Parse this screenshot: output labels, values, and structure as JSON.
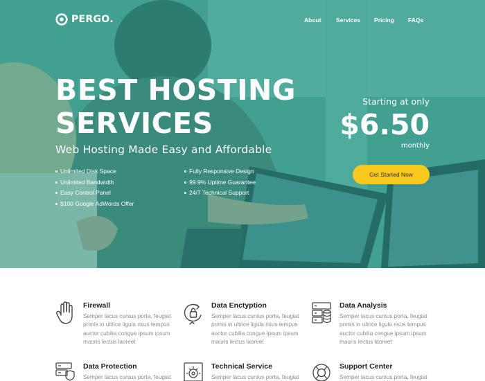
{
  "brand": {
    "name": "PERGO."
  },
  "nav": {
    "items": [
      "About",
      "Services",
      "Pricing",
      "FAQs"
    ]
  },
  "hero": {
    "headline_line1": "BEST HOSTING",
    "headline_line2": "SERVICES",
    "subheadline": "Web Hosting Made Easy and Affordable",
    "features_left": [
      "Unlimited Disk Space",
      "Unlimited Bandwidth",
      "Easy Control Panel",
      "$100 Google AdWords Offer"
    ],
    "features_right": [
      "Fully Responsive Design",
      "99.9% Uptime Guarantee",
      "24/7 Technical Support"
    ],
    "price": {
      "starting_label": "Starting at only",
      "value": "$6.50",
      "period": "monthly"
    },
    "cta_label": "Get Started Now"
  },
  "services": [
    {
      "title": "Firewall",
      "icon": "hand-icon",
      "description": "Semper lacus cursus porta, feugiat primis in ultrice ligula risus tempus auctor cubilia congue ipsum ipsum mauris lectus laoreet"
    },
    {
      "title": "Data Enctyption",
      "icon": "lock-cycle-icon",
      "description": "Semper lacus cursus porta, feugiat primis in ultrice ligula risus tempus auctor cubilia congue ipsum ipsum mauris lectus laoreet"
    },
    {
      "title": "Data Analysis",
      "icon": "server-database-icon",
      "description": "Semper lacus cursus porta, feugiat primis in ultrice ligula risus tempus auctor cubilia congue ipsum ipsum mauris lectus laoreet"
    },
    {
      "title": "Data Protection",
      "icon": "server-shield-icon",
      "description": "Semper lacus cursus porta, feugiat"
    },
    {
      "title": "Technical Service",
      "icon": "gear-frame-icon",
      "description": "Semper lacus cursus porta, feugiat"
    },
    {
      "title": "Support Center",
      "icon": "lifebuoy-icon",
      "description": "Semper lacus cursus porta, feugiat"
    }
  ],
  "colors": {
    "accent": "#2fa392",
    "cta": "#f8c81d",
    "body_text": "#8a8a8a",
    "heading_text": "#222222"
  }
}
